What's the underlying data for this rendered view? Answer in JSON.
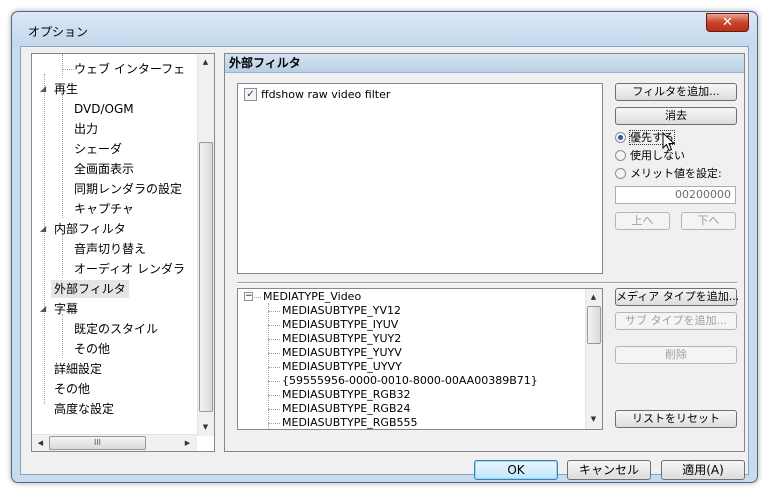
{
  "window": {
    "title": "オプション",
    "close_glyph": "✕"
  },
  "tree": {
    "items": [
      {
        "label": "ウェブ インターフェ",
        "level": 2
      },
      {
        "label": "再生",
        "level": 1,
        "expanded": true
      },
      {
        "label": "DVD/OGM",
        "level": 2
      },
      {
        "label": "出力",
        "level": 2
      },
      {
        "label": "シェーダ",
        "level": 2
      },
      {
        "label": "全画面表示",
        "level": 2
      },
      {
        "label": "同期レンダラの設定",
        "level": 2
      },
      {
        "label": "キャプチャ",
        "level": 2
      },
      {
        "label": "内部フィルタ",
        "level": 1,
        "expanded": true
      },
      {
        "label": "音声切り替え",
        "level": 2
      },
      {
        "label": "オーディオ レンダラ",
        "level": 2
      },
      {
        "label": "外部フィルタ",
        "level": 1,
        "selected": true
      },
      {
        "label": "字幕",
        "level": 1,
        "expanded": true
      },
      {
        "label": "既定のスタイル",
        "level": 2
      },
      {
        "label": "その他",
        "level": 2
      },
      {
        "label": "詳細設定",
        "level": 1
      },
      {
        "label": "その他",
        "level": 1
      },
      {
        "label": "高度な設定",
        "level": 1
      }
    ],
    "expander_glyph": "◢",
    "hscroll_thumb_glyph": "III"
  },
  "panel": {
    "title": "外部フィルタ",
    "filters": [
      {
        "label": "ffdshow raw video filter",
        "checked": true
      }
    ],
    "check_glyph": "✓",
    "buttons": {
      "add_filter": "フィルタを追加...",
      "remove": "消去",
      "up": "上へ",
      "down": "下へ",
      "add_media_type": "メディア タイプを追加...",
      "add_subtype": "サブ タイプを追加...",
      "delete": "削除",
      "reset_list": "リストをリセット"
    },
    "radios": [
      {
        "label": "優先する",
        "checked": true
      },
      {
        "label": "使用しない",
        "checked": false
      },
      {
        "label": "メリット値を設定:",
        "checked": false
      }
    ],
    "merit_value": "00200000",
    "media_types": {
      "root": "MEDIATYPE_Video",
      "subtypes": [
        "MEDIASUBTYPE_YV12",
        "MEDIASUBTYPE_IYUV",
        "MEDIASUBTYPE_YUY2",
        "MEDIASUBTYPE_YUYV",
        "MEDIASUBTYPE_UYVY",
        "{59555956-0000-0010-8000-00AA00389B71}",
        "MEDIASUBTYPE_RGB32",
        "MEDIASUBTYPE_RGB24",
        "MEDIASUBTYPE_RGB555"
      ]
    }
  },
  "footer": {
    "ok": "OK",
    "cancel": "キャンセル",
    "apply": "適用(A)"
  }
}
